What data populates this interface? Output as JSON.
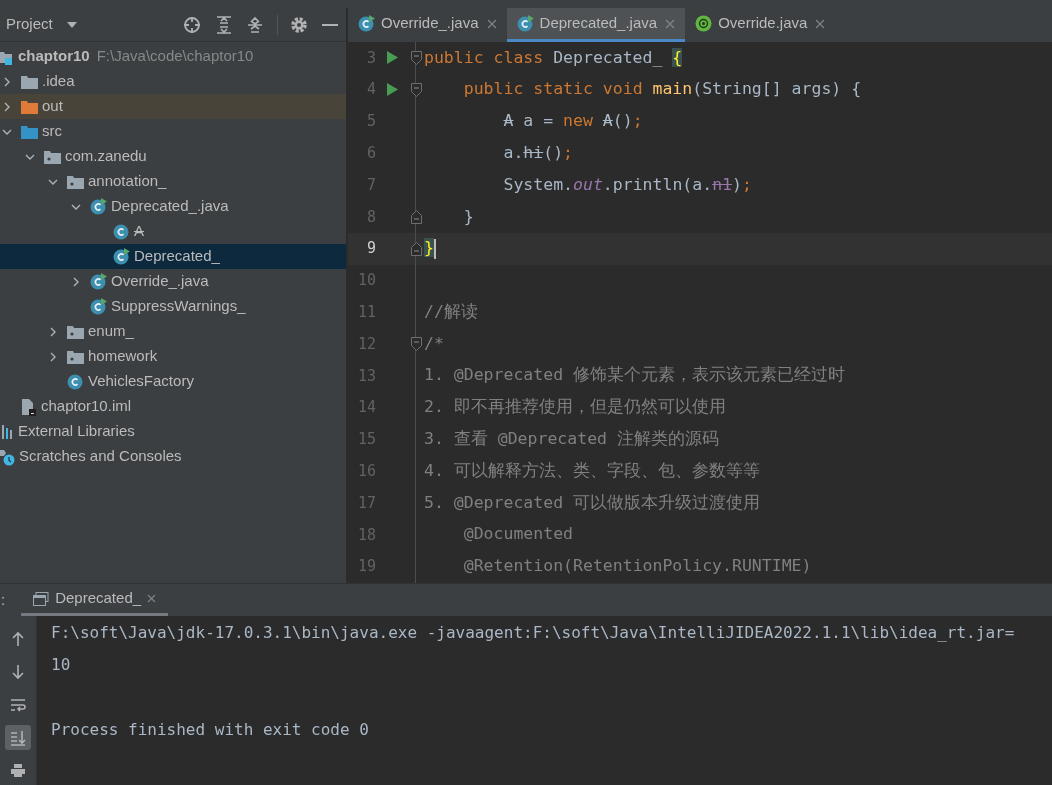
{
  "project_panel": {
    "title": "Project",
    "tree": [
      {
        "label": "chaptor10",
        "path": "F:\\Java\\code\\chaptor10",
        "kind": "module",
        "selected": false,
        "children": [
          {
            "label": ".idea",
            "kind": "folder",
            "expanded": false,
            "selected": false
          },
          {
            "label": "out",
            "kind": "excluded-folder",
            "expanded": false,
            "selected": false
          },
          {
            "label": "src",
            "kind": "source-folder",
            "expanded": true,
            "selected": false,
            "children": [
              {
                "label": "com.zanedu",
                "kind": "package",
                "expanded": true,
                "selected": false,
                "children": [
                  {
                    "label": "annotation_",
                    "kind": "package",
                    "expanded": true,
                    "selected": false,
                    "children": [
                      {
                        "label": "Deprecated_.java",
                        "kind": "runnable-class",
                        "expanded": true,
                        "selected": false,
                        "children": [
                          {
                            "label": "A",
                            "kind": "deprecated-class",
                            "selected": false
                          },
                          {
                            "label": "Deprecated_",
                            "kind": "runnable-class",
                            "selected": true
                          }
                        ]
                      },
                      {
                        "label": "Override_.java",
                        "kind": "runnable-class",
                        "expanded": false,
                        "selected": false
                      },
                      {
                        "label": "SuppressWarnings_",
                        "kind": "runnable-class",
                        "selected": false
                      }
                    ]
                  },
                  {
                    "label": "enum_",
                    "kind": "package",
                    "expanded": false,
                    "selected": false
                  },
                  {
                    "label": "homework",
                    "kind": "package",
                    "expanded": false,
                    "selected": false
                  },
                  {
                    "label": "VehiclesFactory",
                    "kind": "class",
                    "selected": false
                  }
                ]
              }
            ]
          },
          {
            "label": "chaptor10.iml",
            "kind": "iml",
            "selected": false
          }
        ]
      },
      {
        "label": "External Libraries",
        "kind": "libraries",
        "selected": false
      },
      {
        "label": "Scratches and Consoles",
        "kind": "scratches",
        "selected": false
      }
    ]
  },
  "editor_tabs": [
    {
      "label": "Override_.java",
      "kind": "runnable-class",
      "selected": false
    },
    {
      "label": "Deprecated_.java",
      "kind": "runnable-class",
      "selected": true
    },
    {
      "label": "Override.java",
      "kind": "annotation",
      "selected": false
    }
  ],
  "code_lines": [
    {
      "number": "3",
      "run": true,
      "current": false,
      "fold_open": true,
      "fold_close": false,
      "tokens": [
        {
          "text": "public class ",
          "kind": "keyword"
        },
        {
          "text": "Deprecated_ ",
          "kind": "plain"
        },
        {
          "text": "{",
          "kind": "brace-match"
        }
      ]
    },
    {
      "number": "4",
      "run": true,
      "current": false,
      "fold_open": true,
      "fold_close": false,
      "tokens": [
        {
          "text": "    public static void ",
          "kind": "keyword"
        },
        {
          "text": "main",
          "kind": "method"
        },
        {
          "text": "(String[] args) {",
          "kind": "plain"
        }
      ]
    },
    {
      "number": "5",
      "run": false,
      "current": false,
      "fold_open": false,
      "fold_close": false,
      "tokens": [
        {
          "text": "        A",
          "kind": "deprecated"
        },
        {
          "text": " a = ",
          "kind": "plain"
        },
        {
          "text": "new ",
          "kind": "keyword"
        },
        {
          "text": "A",
          "kind": "deprecated"
        },
        {
          "text": "()",
          "kind": "plain"
        },
        {
          "text": ";",
          "kind": "keyword"
        }
      ]
    },
    {
      "number": "6",
      "run": false,
      "current": false,
      "fold_open": false,
      "fold_close": false,
      "tokens": [
        {
          "text": "        a.",
          "kind": "plain"
        },
        {
          "text": "hi",
          "kind": "deprecated"
        },
        {
          "text": "()",
          "kind": "plain"
        },
        {
          "text": ";",
          "kind": "keyword"
        }
      ]
    },
    {
      "number": "7",
      "run": false,
      "current": false,
      "fold_open": false,
      "fold_close": false,
      "tokens": [
        {
          "text": "        System.",
          "kind": "plain"
        },
        {
          "text": "out",
          "kind": "static-field"
        },
        {
          "text": ".println(a.",
          "kind": "plain"
        },
        {
          "text": "n1",
          "kind": "deprecated-field"
        },
        {
          "text": ")",
          "kind": "plain"
        },
        {
          "text": ";",
          "kind": "keyword"
        }
      ]
    },
    {
      "number": "8",
      "run": false,
      "current": false,
      "fold_open": false,
      "fold_close": true,
      "tokens": [
        {
          "text": "    }",
          "kind": "plain"
        }
      ]
    },
    {
      "number": "9",
      "run": false,
      "current": true,
      "fold_open": false,
      "fold_close": true,
      "tokens": [
        {
          "text": "}",
          "kind": "brace-match"
        }
      ]
    },
    {
      "number": "10",
      "run": false,
      "current": false,
      "fold_open": false,
      "fold_close": false
    },
    {
      "number": "11",
      "run": false,
      "current": false,
      "fold_open": false,
      "fold_close": false,
      "tokens": [
        {
          "text": "//解读",
          "kind": "comment"
        }
      ]
    },
    {
      "number": "12",
      "run": false,
      "current": false,
      "fold_open": true,
      "fold_close": false,
      "tokens": [
        {
          "text": "/*",
          "kind": "comment"
        }
      ]
    },
    {
      "number": "13",
      "run": false,
      "current": false,
      "fold_open": false,
      "fold_close": false,
      "tokens": [
        {
          "text": "1. @Deprecated 修饰某个元素，表示该元素已经过时",
          "kind": "comment"
        }
      ]
    },
    {
      "number": "14",
      "run": false,
      "current": false,
      "fold_open": false,
      "fold_close": false,
      "tokens": [
        {
          "text": "2. 即不再推荐使用，但是仍然可以使用",
          "kind": "comment"
        }
      ]
    },
    {
      "number": "15",
      "run": false,
      "current": false,
      "fold_open": false,
      "fold_close": false,
      "tokens": [
        {
          "text": "3. 查看 @Deprecated 注解类的源码",
          "kind": "comment"
        }
      ]
    },
    {
      "number": "16",
      "run": false,
      "current": false,
      "fold_open": false,
      "fold_close": false,
      "tokens": [
        {
          "text": "4. 可以解释方法、类、字段、包、参数等等",
          "kind": "comment"
        }
      ]
    },
    {
      "number": "17",
      "run": false,
      "current": false,
      "fold_open": false,
      "fold_close": false,
      "tokens": [
        {
          "text": "5. @Deprecated 可以做版本升级过渡使用",
          "kind": "comment"
        }
      ]
    },
    {
      "number": "18",
      "run": false,
      "current": false,
      "fold_open": false,
      "fold_close": false,
      "tokens": [
        {
          "text": "    @Documented",
          "kind": "comment"
        }
      ]
    },
    {
      "number": "19",
      "run": false,
      "current": false,
      "fold_open": false,
      "fold_close": false,
      "tokens": [
        {
          "text": "    @Retention(RetentionPolicy.RUNTIME)",
          "kind": "comment"
        }
      ]
    }
  ],
  "run_panel": {
    "label": ":",
    "tab": {
      "label": "Deprecated_",
      "selected": true
    },
    "toolbar": [
      {
        "kind": "up",
        "on": false
      },
      {
        "kind": "down",
        "on": false
      },
      {
        "kind": "wrap",
        "on": false
      },
      {
        "kind": "scroll-end",
        "on": true
      },
      {
        "kind": "print",
        "on": false
      }
    ],
    "output": [
      {
        "text": "F:\\soft\\Java\\jdk-17.0.3.1\\bin\\java.exe -javaagent:F:\\soft\\Java\\IntelliJIDEA2022.1.1\\lib\\idea_rt.jar=",
        "gap_before": false
      },
      {
        "text": "10",
        "gap_before": false
      },
      {
        "text": "Process finished with exit code 0",
        "gap_before": true
      }
    ]
  }
}
